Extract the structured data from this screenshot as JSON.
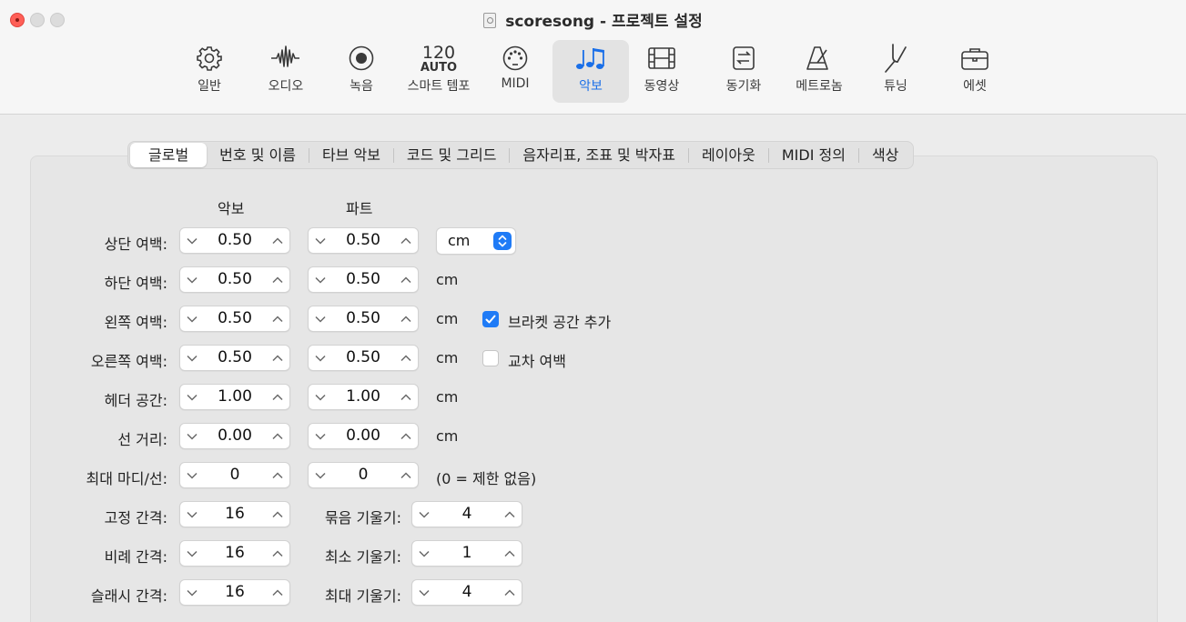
{
  "window": {
    "title": "scoresong - 프로젝트 설정"
  },
  "toolbar": {
    "items": [
      {
        "label": "일반",
        "icon": "gear-icon"
      },
      {
        "label": "오디오",
        "icon": "waveform-icon"
      },
      {
        "label": "녹음",
        "icon": "record-icon"
      },
      {
        "label": "스마트 템포",
        "icon": "tempo-icon",
        "tempo_value": "120",
        "tempo_mode": "AUTO"
      },
      {
        "label": "MIDI",
        "icon": "midi-port-icon"
      },
      {
        "label": "악보",
        "icon": "notes-icon",
        "active": true
      },
      {
        "label": "동영상",
        "icon": "film-icon"
      },
      {
        "label": "동기화",
        "icon": "sync-icon"
      },
      {
        "label": "메트로놈",
        "icon": "metronome-icon"
      },
      {
        "label": "튜닝",
        "icon": "tuning-fork-icon"
      },
      {
        "label": "에셋",
        "icon": "briefcase-icon"
      }
    ],
    "active_color": "#1a6fe8"
  },
  "tabs": [
    {
      "label": "글로벌",
      "active": true
    },
    {
      "label": "번호 및 이름"
    },
    {
      "label": "타브 악보"
    },
    {
      "label": "코드 및 그리드"
    },
    {
      "label": "음자리표, 조표 및 박자표"
    },
    {
      "label": "레이아웃"
    },
    {
      "label": "MIDI 정의"
    },
    {
      "label": "색상"
    }
  ],
  "columns": {
    "score": "악보",
    "part": "파트"
  },
  "rows": [
    {
      "label": "상단 여백:",
      "score": "0.50",
      "part": "0.50"
    },
    {
      "label": "하단 여백:",
      "score": "0.50",
      "part": "0.50",
      "unit": "cm"
    },
    {
      "label": "왼쪽 여백:",
      "score": "0.50",
      "part": "0.50",
      "unit": "cm"
    },
    {
      "label": "오른쪽 여백:",
      "score": "0.50",
      "part": "0.50",
      "unit": "cm"
    },
    {
      "label": "헤더 공간:",
      "score": "1.00",
      "part": "1.00",
      "unit": "cm"
    },
    {
      "label": "선 거리:",
      "score": "0.00",
      "part": "0.00",
      "unit": "cm"
    },
    {
      "label": "최대 마디/선:",
      "score": "0",
      "part": "0",
      "unit": "(0 = 제한 없음)"
    }
  ],
  "unit_popup": {
    "value": "cm"
  },
  "checkboxes": {
    "bracket_space": {
      "label": "브라켓 공간 추가",
      "checked": true
    },
    "alternating_margins": {
      "label": "교차 여백",
      "checked": false
    }
  },
  "spacing": [
    {
      "label": "고정 간격:",
      "value": "16",
      "beam_label": "묶음 기울기:",
      "beam_value": "4"
    },
    {
      "label": "비례 간격:",
      "value": "16",
      "beam_label": "최소 기울기:",
      "beam_value": "1"
    },
    {
      "label": "슬래시 간격:",
      "value": "16",
      "beam_label": "최대 기울기:",
      "beam_value": "4"
    }
  ]
}
